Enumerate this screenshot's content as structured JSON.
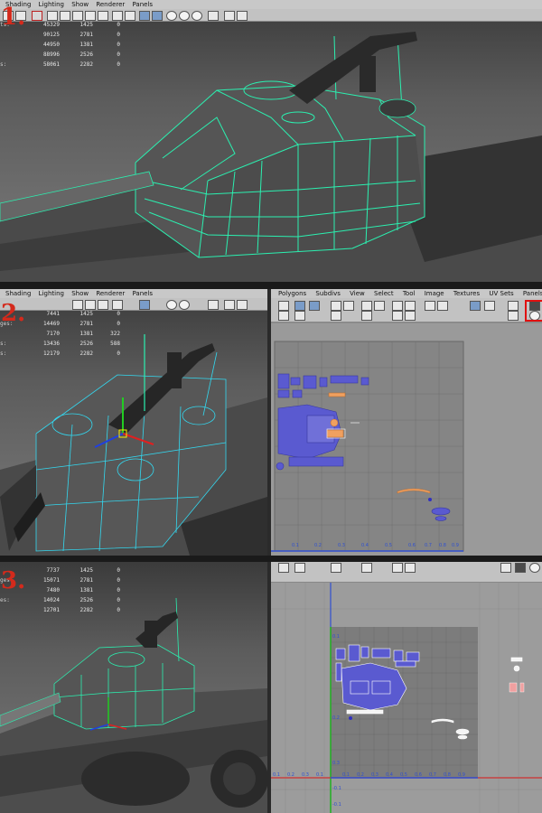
{
  "steps": [
    {
      "number": "1.",
      "menu": [
        "Shading",
        "Lighting",
        "Show",
        "Renderer",
        "Panels"
      ],
      "stats": [
        {
          "label": "ts:",
          "values": [
            "45329",
            "1425",
            "0"
          ]
        },
        {
          "label": "",
          "values": [
            "90125",
            "2781",
            "0"
          ]
        },
        {
          "label": "",
          "values": [
            "44950",
            "1381",
            "0"
          ]
        },
        {
          "label": "",
          "values": [
            "88996",
            "2526",
            "0"
          ]
        },
        {
          "label": "s:",
          "values": [
            "58061",
            "2282",
            "0"
          ]
        }
      ]
    },
    {
      "number": "2.",
      "menu": [
        "Shading",
        "Lighting",
        "Show",
        "Renderer",
        "Panels"
      ],
      "stats": [
        {
          "label": "",
          "values": [
            "7441",
            "1425",
            "0"
          ]
        },
        {
          "label": "ges:",
          "values": [
            "14469",
            "2781",
            "0"
          ]
        },
        {
          "label": "",
          "values": [
            "7170",
            "1381",
            "322"
          ]
        },
        {
          "label": "s:",
          "values": [
            "13436",
            "2526",
            "588"
          ]
        },
        {
          "label": "s:",
          "values": [
            "12179",
            "2282",
            "0"
          ]
        }
      ],
      "uv_menu": [
        "Polygons",
        "Subdivs",
        "View",
        "Select",
        "Tool",
        "Image",
        "Textures",
        "UV Sets",
        "Panels"
      ],
      "uv_axis": [
        "0.1",
        "0.2",
        "0.3",
        "0.4",
        "0.5",
        "0.6",
        "0.7",
        "0.8",
        "0.9"
      ]
    },
    {
      "number": "3.",
      "stats": [
        {
          "label": "",
          "values": [
            "7737",
            "1425",
            "0"
          ]
        },
        {
          "label": "ges:",
          "values": [
            "15071",
            "2781",
            "0"
          ]
        },
        {
          "label": "",
          "values": [
            "7480",
            "1381",
            "0"
          ]
        },
        {
          "label": "es:",
          "values": [
            "14024",
            "2526",
            "0"
          ]
        },
        {
          "label": "",
          "values": [
            "12701",
            "2282",
            "0"
          ]
        }
      ],
      "uv_axis": [
        "0.1",
        "0.2",
        "0.3",
        "0.4",
        "0.5",
        "0.6",
        "0.7",
        "0.8",
        "0.9"
      ],
      "uv_axis_v": [
        "0.1",
        "0.2",
        "0.3"
      ],
      "uv_axis_neg": "-0.1",
      "uv_axis_neg2": "-0.1"
    }
  ],
  "colors": {
    "wire_green": "#2bf0b0",
    "wire_cyan": "#33d8f0",
    "uv_blue": "#5a5ad0",
    "uv_orange": "#f0a060",
    "highlight_red": "#e01010",
    "step_number": "#d42a1c"
  },
  "icons": [
    "uv-editor-icon",
    "grid-icon",
    "snapshot-icon",
    "camera-icon",
    "move-tool-icon"
  ]
}
